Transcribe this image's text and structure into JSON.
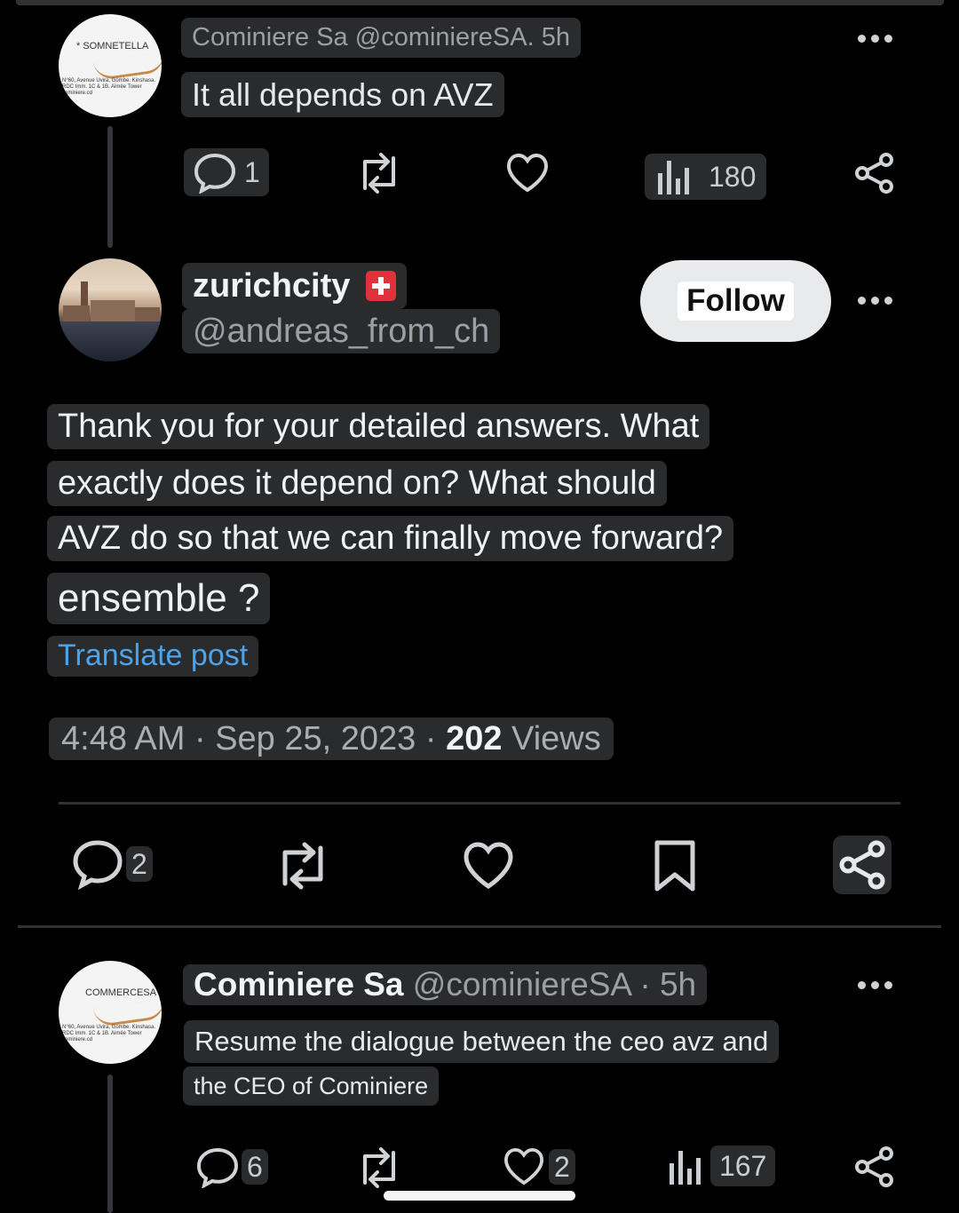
{
  "post1": {
    "display_name": "Cominiere Sa",
    "handle": "@cominiereSA.",
    "time": "5h",
    "text": "It all depends on AVZ",
    "avatar_label": "* SOMNETELLA",
    "avatar_address": "N°60, Avenue Uvira, Gombe. Kinshasa. RDC Imm. 1C & 1B. Aimée Tower cominiere.cd",
    "actions": {
      "reply_count": "1",
      "views": "180"
    },
    "icons": [
      "reply-icon",
      "repost-icon",
      "like-icon",
      "views-icon",
      "share-icon",
      "more-icon"
    ]
  },
  "main_post": {
    "display_name": "zurichcity",
    "flag": "swiss-flag-icon",
    "handle": "@andreas_from_ch",
    "follow_label": "Follow",
    "text_lines": [
      "Thank you for your detailed answers. What",
      "exactly does it depend on? What should",
      "AVZ do so that we can finally move forward?",
      "ensemble ?"
    ],
    "translate_label": "Translate post",
    "time": "4:48 AM",
    "date": "Sep 25, 2023",
    "views_count": "202",
    "views_label": "Views",
    "actions": {
      "reply_count": "2"
    },
    "icons": [
      "reply-icon",
      "repost-icon",
      "like-icon",
      "bookmark-icon",
      "share-icon"
    ]
  },
  "post3": {
    "display_name": "Cominiere Sa",
    "handle": "@cominiereSA",
    "time": "5h",
    "text_lines": [
      "Resume the dialogue between the ceo avz and",
      "the CEO of Cominiere"
    ],
    "avatar_label": "COMMERCESA",
    "avatar_address": "N°60, Avenue Uvira, Gombe. Kinshasa. RDC Imm. 1C & 1B. Aimée Tower cominiere.cd",
    "actions": {
      "reply_count": "6",
      "like_count": "2",
      "views": "167"
    }
  },
  "colors": {
    "background": "#000000",
    "link": "#4da3e8",
    "highlight": "#2a2b2d"
  }
}
